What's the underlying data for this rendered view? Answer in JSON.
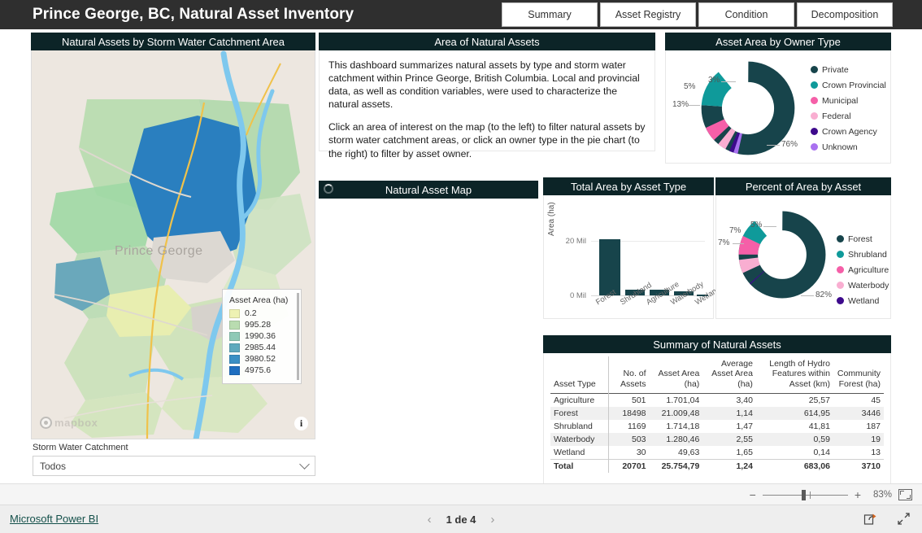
{
  "header": {
    "title": "Prince George, BC, Natural Asset Inventory",
    "tabs": [
      {
        "label": "Summary"
      },
      {
        "label": "Asset Registry"
      },
      {
        "label": "Condition"
      },
      {
        "label": "Decomposition"
      }
    ]
  },
  "map_visual": {
    "title": "Natural Assets by Storm Water Catchment Area",
    "city_label": "Prince George",
    "attribution": "mapbox",
    "info_icon": "info-icon",
    "legend": {
      "title": "Asset Area (ha)",
      "items": [
        {
          "value": "0.2",
          "color": "#eef2b3"
        },
        {
          "value": "995.28",
          "color": "#b9dcb0"
        },
        {
          "value": "1990.36",
          "color": "#8fc9b6"
        },
        {
          "value": "2985.44",
          "color": "#5fa9bd"
        },
        {
          "value": "3980.52",
          "color": "#3a8fc4"
        },
        {
          "value": "4975.6",
          "color": "#1f6fc0"
        }
      ]
    }
  },
  "slicer": {
    "label": "Storm Water Catchment",
    "value": "Todos",
    "chevron": "chevron-down-icon"
  },
  "text_visual": {
    "title": "Area of Natural Assets",
    "paragraphs": [
      "This dashboard summarizes natural assets by type and storm water catchment within Prince George, British Columbia. Local and provincial data, as well as condition variables, were used to characterize the natural assets.",
      "Click an area of interest on the map (to the left) to filter natural assets by storm water catchment areas, or click an owner type in the pie chart (to the right) to filter by asset owner."
    ]
  },
  "natural_asset_map": {
    "title": "Natural Asset Map",
    "spinner": "loading-spinner-icon"
  },
  "table_visual": {
    "title": "Summary of Natural Assets"
  },
  "status_bar": {
    "zoom_out": "−",
    "zoom_in": "+",
    "zoom_level": "83%",
    "fit_icon": "fit-to-page-icon"
  },
  "footer": {
    "link": "Microsoft Power BI",
    "prev": "‹",
    "page_text": "1 de 4",
    "next": "›",
    "share_icon": "share-icon",
    "fullscreen_icon": "fullscreen-icon"
  },
  "chart_data": [
    {
      "type": "pie",
      "title": "Asset Area by Owner Type",
      "legend_position": "right",
      "categories": [
        "Private",
        "Crown Provincial",
        "Municipal",
        "Federal",
        "Crown Agency",
        "Unknown"
      ],
      "values": [
        76,
        13,
        5,
        3,
        1.5,
        1.5
      ],
      "labels": [
        "76%",
        "13%",
        "5%",
        "3%",
        "",
        ""
      ],
      "colors": [
        "#17444b",
        "#0f9a9a",
        "#f55fa8",
        "#f9aed1",
        "#3d0a8c",
        "#a971f0"
      ]
    },
    {
      "type": "bar",
      "title": "Total Area by Asset Type",
      "categories": [
        "Forest",
        "Shrubland",
        "Agriculture",
        "Waterbody",
        "Wetland"
      ],
      "values": [
        21009.48,
        1714.18,
        1701.04,
        1280.46,
        49.63
      ],
      "xlabel": "",
      "ylabel": "Area (ha)",
      "ylim": [
        0,
        24000
      ],
      "ytick_labels": [
        "0 Mil",
        "20 Mil"
      ],
      "ytick_values": [
        0,
        20000
      ],
      "grid": true,
      "color": "#17444b"
    },
    {
      "type": "pie",
      "title": "Percent of Area by Asset",
      "legend_position": "right",
      "categories": [
        "Forest",
        "Shrubland",
        "Agriculture",
        "Waterbody",
        "Wetland"
      ],
      "values": [
        82,
        7,
        7,
        5,
        0.2
      ],
      "labels": [
        "82%",
        "7%",
        "7%",
        "5%",
        ""
      ],
      "colors": [
        "#17444b",
        "#0f9a9a",
        "#f55fa8",
        "#f9aed1",
        "#3d0a8c"
      ]
    },
    {
      "type": "table",
      "title": "Summary of Natural Assets",
      "columns": [
        "Asset Type",
        "No. of Assets",
        "Asset Area (ha)",
        "Average Asset Area (ha)",
        "Length of Hydro Features within Asset (km)",
        "Community Forest (ha)"
      ],
      "rows": [
        [
          "Agriculture",
          "501",
          "1.701,04",
          "3,40",
          "25,57",
          "45"
        ],
        [
          "Forest",
          "18498",
          "21.009,48",
          "1,14",
          "614,95",
          "3446"
        ],
        [
          "Shrubland",
          "1169",
          "1.714,18",
          "1,47",
          "41,81",
          "187"
        ],
        [
          "Waterbody",
          "503",
          "1.280,46",
          "2,55",
          "0,59",
          "19"
        ],
        [
          "Wetland",
          "30",
          "49,63",
          "1,65",
          "0,14",
          "13"
        ]
      ],
      "total_row": [
        "Total",
        "20701",
        "25.754,79",
        "1,24",
        "683,06",
        "3710"
      ]
    }
  ]
}
